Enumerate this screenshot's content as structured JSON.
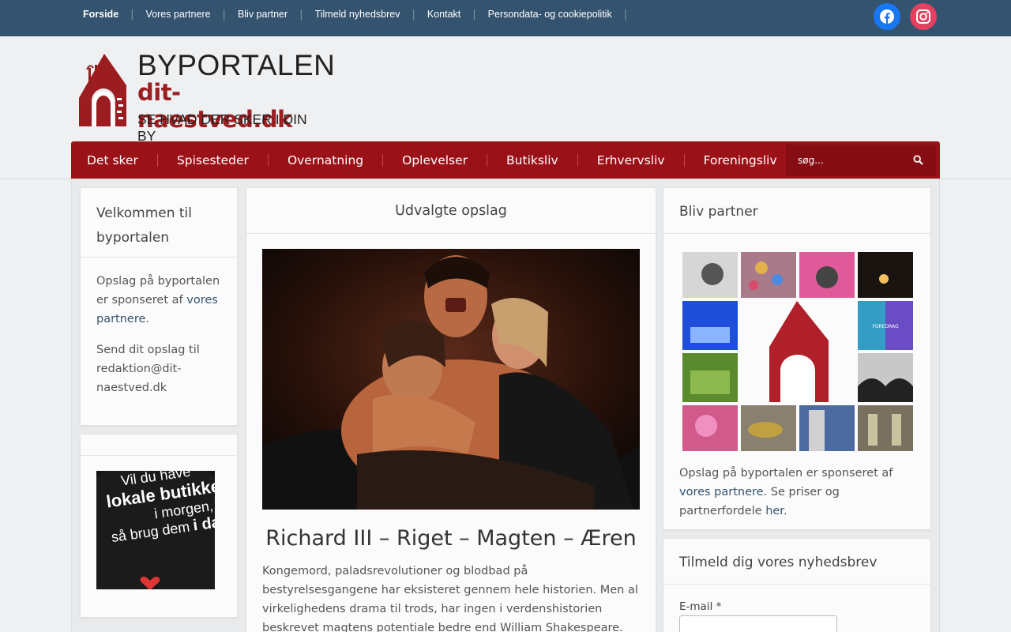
{
  "topnav": {
    "items": [
      {
        "label": "Forside",
        "active": true
      },
      {
        "label": "Vores partnere"
      },
      {
        "label": "Bliv partner"
      },
      {
        "label": "Tilmeld nyhedsbrev"
      },
      {
        "label": "Kontakt"
      },
      {
        "label": "Persondata- og cookiepolitik"
      }
    ],
    "social": [
      {
        "icon": "facebook-icon",
        "color": "#1877f2"
      },
      {
        "icon": "instagram-icon",
        "color": "#e4405f"
      }
    ]
  },
  "logo": {
    "line1": "BYPORTALEN",
    "line2": "dit-naestved.dk",
    "line3": "SE HVAD DER SKER I DIN BY",
    "brand_color": "#9b1d20"
  },
  "mainnav": {
    "items": [
      "Det sker",
      "Spisesteder",
      "Overnatning",
      "Oplevelser",
      "Butiksliv",
      "Erhvervsliv",
      "Foreningsliv"
    ],
    "search_placeholder": "søg...",
    "color": "#9b1118"
  },
  "left_welcome": {
    "title": "Velkommen til byportalen",
    "p1_prefix": "Opslag på byportalen er sponseret af ",
    "p1_link": "vores partnere",
    "p1_suffix": ".",
    "p2": "Send dit opslag til redaktion@dit-naestved.dk"
  },
  "left_ad": {
    "lines": [
      "Vil du have",
      "lokale butikker",
      "i morgen,",
      "så brug dem",
      "i dag..."
    ]
  },
  "featured": {
    "heading": "Udvalgte opslag",
    "post_title": "Richard III – Riget – Magten – Æren",
    "excerpt": "Kongemord, paladsrevolutioner og blodbad på bestyrelsesgangene har eksisteret gennem hele historien. Men al virkelighedens drama til trods, har ingen i verdenshistorien beskrevet magtens potentiale bedre end William Shakespeare."
  },
  "right_partner": {
    "title": "Bliv partner",
    "collage_badge": "FOREDRAG",
    "text_prefix": "Opslag på byportalen er sponseret af ",
    "text_link": "vores partnere",
    "text_mid": ". Se priser og partnerfordele ",
    "text_link2": "her",
    "text_suffix": "."
  },
  "right_newsletter": {
    "title": "Tilmeld dig vores nyhedsbrev",
    "email_label": "E-mail *"
  }
}
